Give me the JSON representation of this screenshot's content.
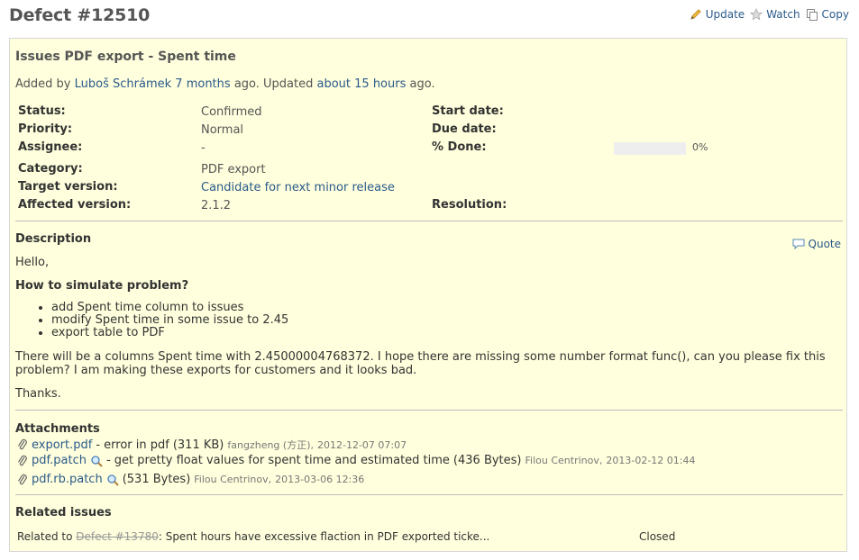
{
  "page": {
    "title": "Defect #12510",
    "actions": {
      "update": "Update",
      "watch": "Watch",
      "copy": "Copy"
    }
  },
  "issue": {
    "subject": "Issues PDF export - Spent time",
    "author_prefix": "Added by",
    "author": "Luboš Schrámek",
    "created": "7 months",
    "updated_prefix": "ago. Updated",
    "updated": "about 15 hours",
    "updated_suffix": "ago.",
    "attributes": {
      "status_label": "Status:",
      "status": "Confirmed",
      "priority_label": "Priority:",
      "priority": "Normal",
      "assignee_label": "Assignee:",
      "assignee": "-",
      "category_label": "Category:",
      "category": "PDF export",
      "target_label": "Target version:",
      "target": "Candidate for next minor release",
      "affected_label": "Affected version:",
      "affected": "2.1.2",
      "start_label": "Start date:",
      "due_label": "Due date:",
      "done_label": "% Done:",
      "done_value": 0,
      "done_text": "0%",
      "resolution_label": "Resolution:"
    },
    "description": {
      "title": "Description",
      "quote": "Quote",
      "greeting": "Hello,",
      "heading": "How to simulate problem?",
      "steps": [
        "add Spent time column to issues",
        "modify Spent time in some issue to 2.45",
        "export table to PDF"
      ],
      "paragraph": "There will be a columns Spent time with 2.45000004768372. I hope there are missing some number format func(), can you please fix this problem? I am making these exports for customers and it looks bad.",
      "thanks": "Thanks."
    },
    "attachments": {
      "title": "Attachments",
      "items": [
        {
          "name": "export.pdf",
          "desc": "- error in pdf",
          "size": "(311 KB)",
          "author": "fangzheng (方正),",
          "date": "2012-12-07 07:07",
          "preview": false
        },
        {
          "name": "pdf.patch",
          "desc": "- get pretty float values for spent time and estimated time",
          "size": "(436 Bytes)",
          "author": "Filou Centrinov,",
          "date": "2013-02-12 01:44",
          "preview": true
        },
        {
          "name": "pdf.rb.patch",
          "desc": "",
          "size": "(531 Bytes)",
          "author": "Filou Centrinov,",
          "date": "2013-03-06 12:36",
          "preview": true
        }
      ]
    },
    "related": {
      "title": "Related issues",
      "relation": "Related to",
      "issue_ref": "Defect #13780",
      "issue_subject": ": Spent hours have excessive flaction in PDF exported ticke...",
      "status": "Closed"
    }
  }
}
